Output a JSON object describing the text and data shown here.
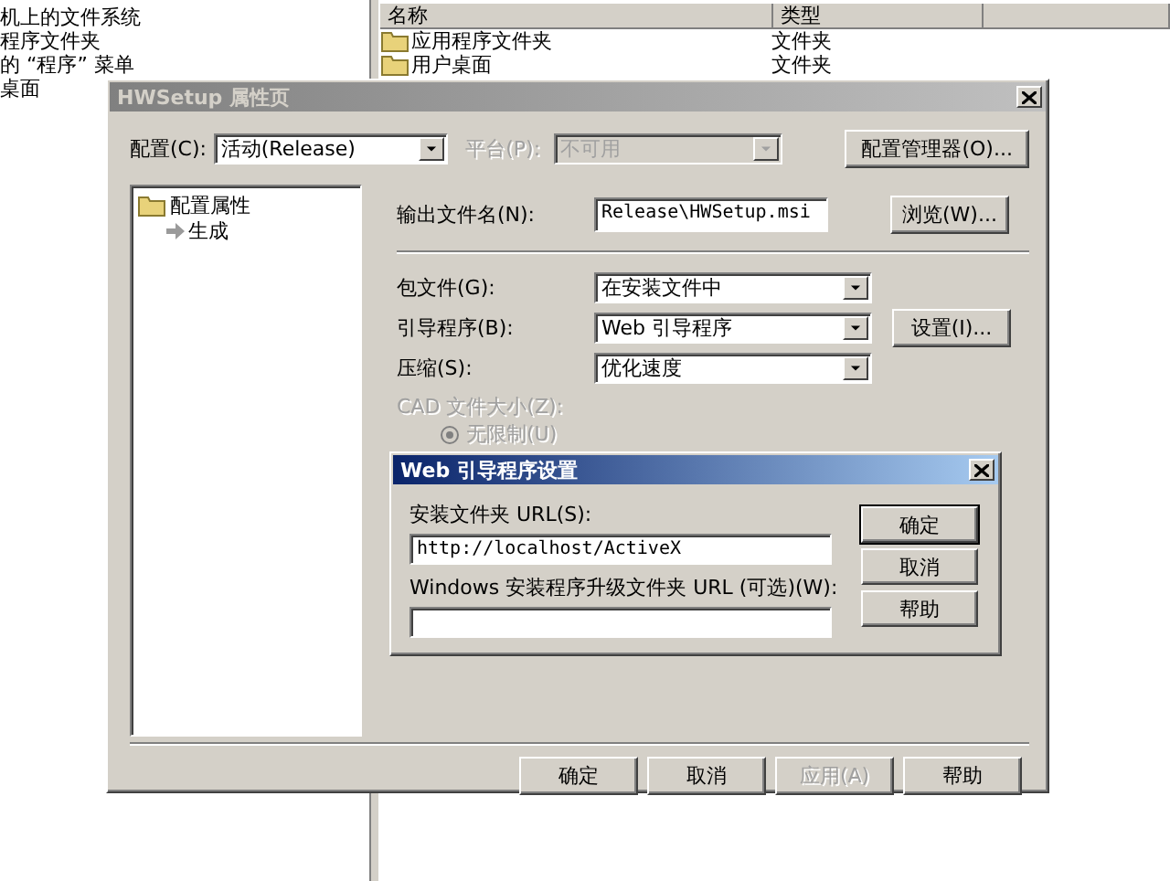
{
  "background": {
    "folder_tree": [
      "机上的文件系统",
      "程序文件夹",
      "的 “程序” 菜单",
      "桌面"
    ],
    "list": {
      "columns": [
        "名称",
        "类型"
      ],
      "rows": [
        {
          "name": "应用程序文件夹",
          "type": "文件夹"
        },
        {
          "name": "用户桌面",
          "type": "文件夹"
        }
      ]
    }
  },
  "property_dialog": {
    "title": "HWSetup 属性页",
    "active": false,
    "configuration": {
      "label": "配置(C):",
      "value": "活动(Release)",
      "disabled": false
    },
    "platform": {
      "label": "平台(P):",
      "value": "不可用",
      "disabled": true
    },
    "config_manager_button": "配置管理器(O)...",
    "tree": [
      {
        "label": "配置属性",
        "children": [
          {
            "label": "生成"
          }
        ]
      }
    ],
    "output": {
      "label": "输出文件名(N):",
      "value": "Release\\HWSetup.msi",
      "button": "浏览(W)..."
    },
    "fields": [
      {
        "label": "包文件(G):",
        "value": "在安装文件中"
      },
      {
        "label": "引导程序(B):",
        "value": "Web 引导程序",
        "button": "设置(I)..."
      },
      {
        "label": "压缩(S):",
        "value": "优化速度"
      }
    ],
    "cad_size": {
      "label": "CAD 文件大小(Z):",
      "disabled": true,
      "options": [
        {
          "label": "无限制(U)",
          "selected": true
        }
      ]
    },
    "buttons": [
      {
        "label": "确定",
        "disabled": false
      },
      {
        "label": "取消",
        "disabled": false
      },
      {
        "label": "应用(A)",
        "disabled": true
      },
      {
        "label": "帮助",
        "disabled": false
      }
    ]
  },
  "bootstrapper_dialog": {
    "title": "Web 引导程序设置",
    "active": true,
    "fields": [
      {
        "label": "安装文件夹 URL(S):",
        "value": "http://localhost/ActiveX"
      },
      {
        "label": "Windows 安装程序升级文件夹 URL (可选)(W):"
      }
    ],
    "buttons": [
      {
        "label": "确定",
        "default": true
      },
      {
        "label": "取消",
        "default": false
      },
      {
        "label": "帮助",
        "default": false
      }
    ]
  }
}
